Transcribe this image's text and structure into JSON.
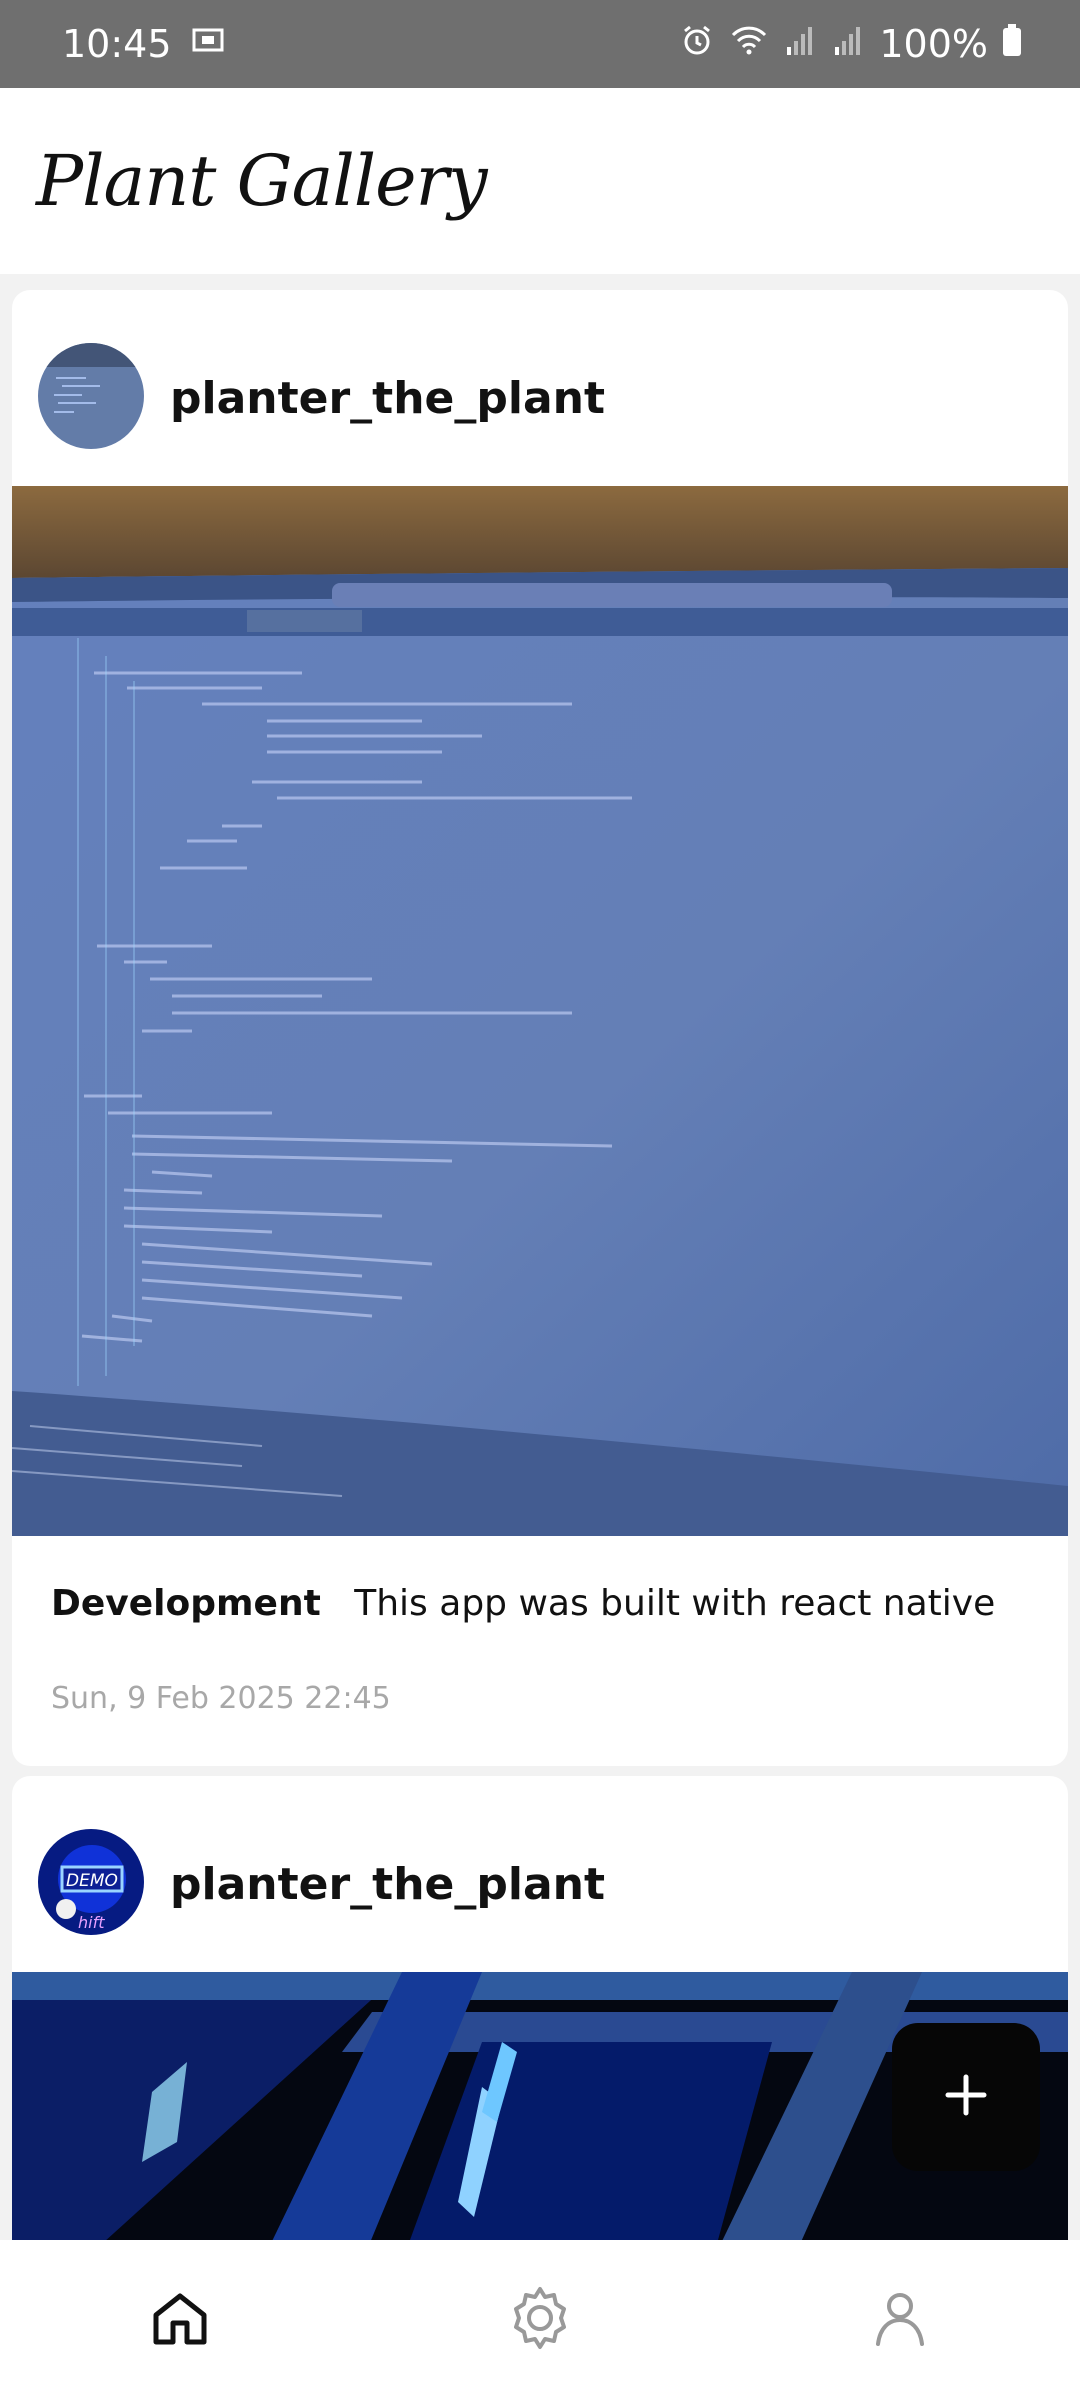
{
  "status_bar": {
    "time": "10:45",
    "battery": "100%",
    "icons": [
      "screen-record-icon",
      "alarm-icon",
      "wifi-icon",
      "signal-icon",
      "signal-icon",
      "battery-icon"
    ]
  },
  "header": {
    "title": "Plant Gallery"
  },
  "posts": [
    {
      "username": "planter_the_plant",
      "category": "Development",
      "description": "This app was built with react native",
      "date": "Sun, 9 Feb 2025  22:45"
    },
    {
      "username": "planter_the_plant",
      "avatar_text": "DEMO",
      "avatar_subtext": "hift"
    }
  ],
  "fab": {
    "icon": "plus-icon",
    "background": "#060606"
  },
  "bottom_nav": {
    "items": [
      {
        "icon": "home-icon",
        "active": true
      },
      {
        "icon": "gear-icon",
        "active": false
      },
      {
        "icon": "user-icon",
        "active": false
      }
    ]
  },
  "colors": {
    "status_bar_bg": "#6f6f6f",
    "code_bg": "#5874b0",
    "date_text": "#a8a8a8"
  }
}
